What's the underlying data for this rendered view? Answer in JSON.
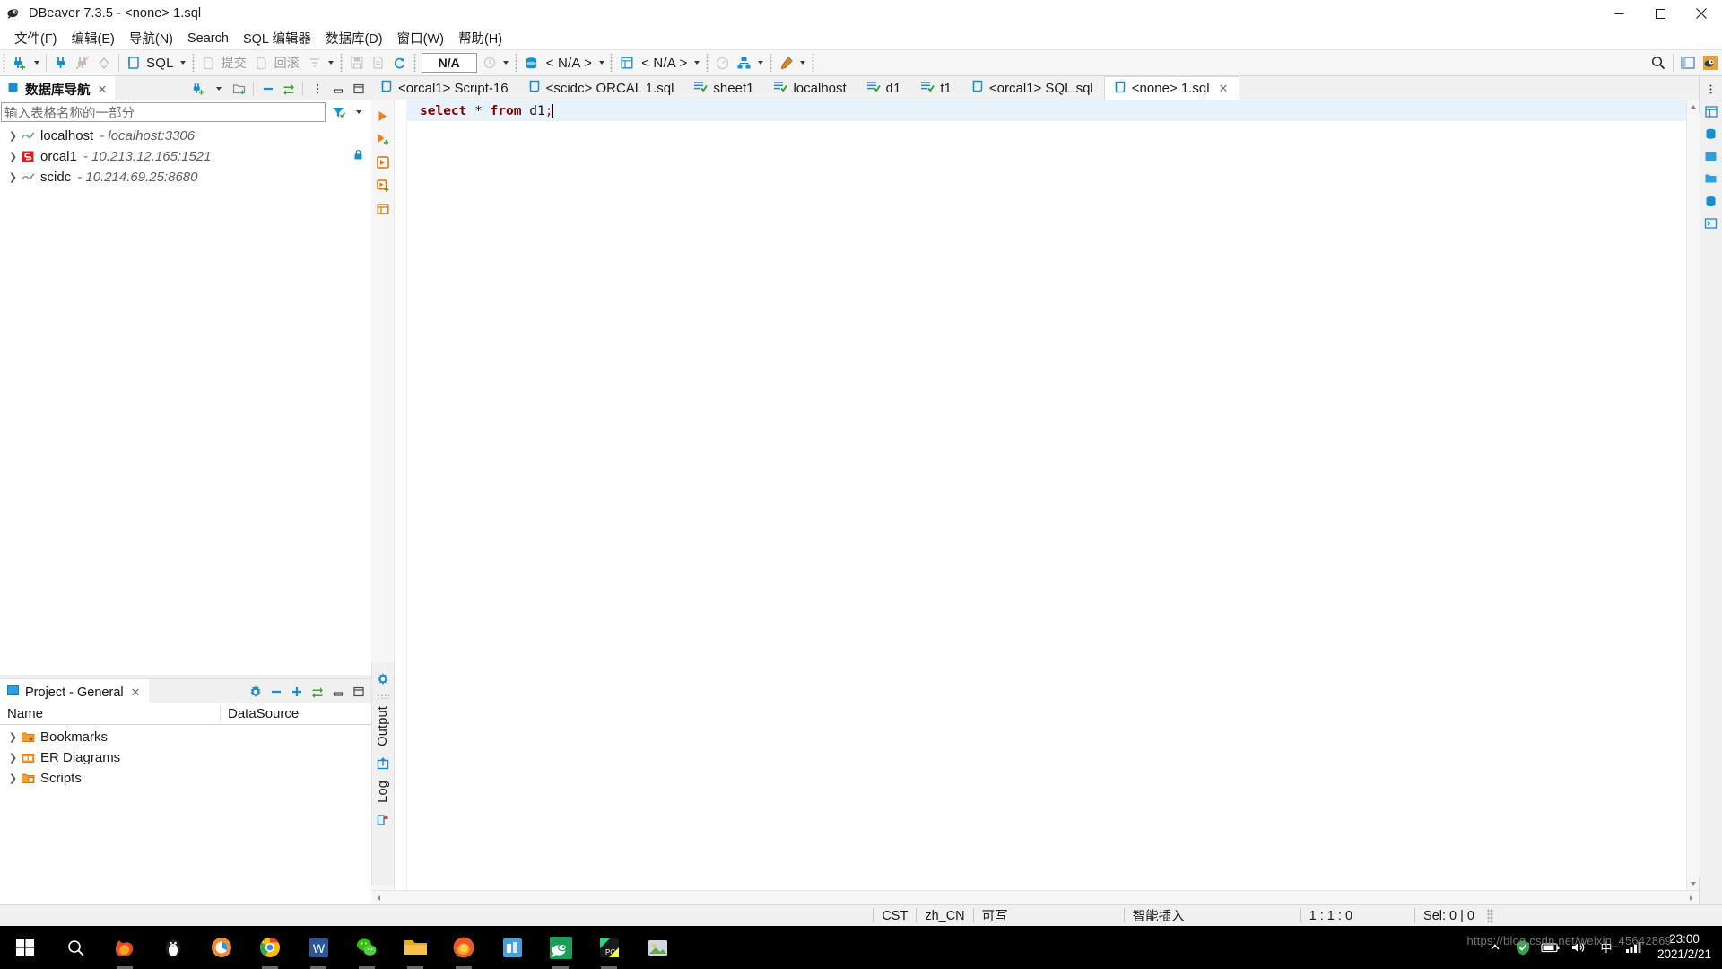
{
  "window": {
    "title": "DBeaver 7.3.5 - <none> 1.sql",
    "app_icon": "dbeaver-icon",
    "minimize": "minimize-icon",
    "maximize": "maximize-icon",
    "close": "close-icon"
  },
  "menubar": {
    "items": [
      {
        "label": "文件(F)",
        "mnemonic": "F"
      },
      {
        "label": "编辑(E)",
        "mnemonic": "E"
      },
      {
        "label": "导航(N)",
        "mnemonic": "N"
      },
      {
        "label": "Search",
        "mnemonic": "a"
      },
      {
        "label": "SQL 编辑器",
        "mnemonic": "S"
      },
      {
        "label": "数据库(D)",
        "mnemonic": "D"
      },
      {
        "label": "窗口(W)",
        "mnemonic": "W"
      },
      {
        "label": "帮助(H)",
        "mnemonic": "H"
      }
    ]
  },
  "toolbar": {
    "new_connection": "new-connection-icon",
    "connect": "connect-icon",
    "disconnect": "disconnect-icon",
    "invalidate": "invalidate-icon",
    "sql_editor_label": "SQL",
    "commit_label": "提交",
    "rollback_label": "回滚",
    "transaction_mode": "transaction-mode-icon",
    "save_icon": "save-icon",
    "save_as_icon": "save-as-icon",
    "refresh_icon": "refresh-icon",
    "schema_value": "N/A",
    "history_icon": "history-icon",
    "datasource_value": "< N/A >",
    "database_value": "< N/A >",
    "performance_icon": "dashboard-icon",
    "layout_icon": "layout-icon",
    "tools_icon": "tools-icon",
    "search_icon": "search-icon",
    "perspective_icon": "perspective-icon",
    "dbeaver_perspective_icon": "dbeaver-perspective-icon"
  },
  "navigator": {
    "tab_label": "数据库导航",
    "tab_close": "close-icon",
    "tools": [
      "new-connection-icon",
      "dropdown-caret-icon",
      "new-folder-icon",
      "collapse-all-icon",
      "link-editor-icon",
      "view-menu-icon",
      "minimize-icon",
      "maximize-icon"
    ],
    "filter_placeholder": "输入表格名称的一部分",
    "filter_icon": "filter-icon",
    "filter_caret": "chevron-down-icon",
    "connections": [
      {
        "name": "localhost",
        "host": "- localhost:3306",
        "icon": "mysql-icon",
        "expanded": false
      },
      {
        "name": "orcal1",
        "host": "- 10.213.12.165:1521",
        "icon": "oracle-icon",
        "expanded": false
      },
      {
        "name": "scidc",
        "host": "- 10.214.69.25:8680",
        "icon": "mysql-icon",
        "expanded": false
      }
    ]
  },
  "project": {
    "tab_label": "Project - General",
    "tab_close": "close-icon",
    "tools": [
      "settings-icon",
      "collapse-all-icon",
      "expand-all-icon",
      "link-editor-icon",
      "minimize-icon",
      "maximize-icon"
    ],
    "columns": [
      "Name",
      "DataSource"
    ],
    "rows": [
      {
        "name": "Bookmarks",
        "icon": "bookmarks-folder-icon",
        "datasource": ""
      },
      {
        "name": "ER Diagrams",
        "icon": "er-diagram-folder-icon",
        "datasource": ""
      },
      {
        "name": "Scripts",
        "icon": "scripts-folder-icon",
        "datasource": ""
      }
    ]
  },
  "editor": {
    "tabs": [
      {
        "label": "<orcal1> Script-16",
        "icon": "sql-file-icon",
        "active": false,
        "closable": false
      },
      {
        "label": "<scidc> ORCAL 1.sql",
        "icon": "sql-file-icon",
        "active": false,
        "closable": false
      },
      {
        "label": "sheet1",
        "icon": "result-grid-icon",
        "active": false,
        "closable": false
      },
      {
        "label": "localhost",
        "icon": "result-grid-icon",
        "active": false,
        "closable": false
      },
      {
        "label": "d1",
        "icon": "result-grid-icon",
        "active": false,
        "closable": false
      },
      {
        "label": "t1",
        "icon": "result-grid-icon",
        "active": false,
        "closable": false
      },
      {
        "label": "<orcal1> SQL.sql",
        "icon": "sql-file-icon",
        "active": false,
        "closable": false
      },
      {
        "label": "<none> 1.sql",
        "icon": "sql-file-icon",
        "active": true,
        "closable": true
      }
    ],
    "gutter_actions": [
      "execute-statement-icon",
      "execute-script-icon",
      "execute-new-tab-icon",
      "execute-expression-icon",
      "explain-plan-icon"
    ],
    "code": {
      "line1": {
        "keyword1": "select",
        "star": "*",
        "keyword2": "from",
        "table": "d1",
        "terminator": ";"
      }
    },
    "colors": {
      "keyword": "#7b0000",
      "terminator": "#d60000",
      "current_line_bg": "#e8f2fb"
    }
  },
  "side_panels": {
    "settings_icon": "settings-icon",
    "output_label": "Output",
    "output_icon": "output-icon",
    "log_label": "Log",
    "log_icon": "log-icon"
  },
  "statusbar": {
    "timezone": "CST",
    "locale": "zh_CN",
    "writable": "可写",
    "insert_mode": "智能插入",
    "position": "1 : 1 : 0",
    "selection": "Sel: 0 | 0"
  },
  "taskbar": {
    "start_icon": "windows-start-icon",
    "search_icon": "search-icon",
    "apps": [
      {
        "name": "firefox-dev-icon",
        "active": false,
        "running": true
      },
      {
        "name": "penguin-icon",
        "active": false,
        "running": false
      },
      {
        "name": "browser-icon",
        "active": false,
        "running": false
      },
      {
        "name": "chrome-icon",
        "active": false,
        "running": true
      },
      {
        "name": "word-icon",
        "active": false,
        "running": true
      },
      {
        "name": "wechat-icon",
        "active": false,
        "running": true
      },
      {
        "name": "file-explorer-icon",
        "active": false,
        "running": true
      },
      {
        "name": "firefox-icon",
        "active": false,
        "running": true
      },
      {
        "name": "store-icon",
        "active": false,
        "running": false
      },
      {
        "name": "dbeaver-icon",
        "active": true,
        "running": true
      },
      {
        "name": "pycharm-icon",
        "active": false,
        "running": true
      },
      {
        "name": "image-viewer-icon",
        "active": false,
        "running": false
      }
    ],
    "tray": [
      "chevron-up-icon",
      "security-icon",
      "battery-icon",
      "volume-icon",
      "ime-icon",
      "network-icon"
    ],
    "clock_time": "23:00",
    "clock_date": "2021/2/21"
  },
  "watermark": "https://blog.csdn.net/weixin_45642869"
}
